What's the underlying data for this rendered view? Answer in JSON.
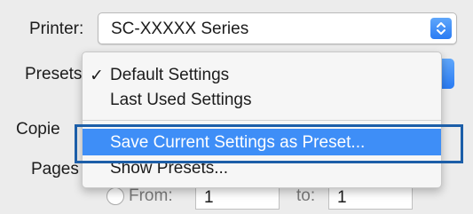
{
  "printer": {
    "label": "Printer:",
    "value": "SC-XXXXX Series",
    "stepper_icon": "updown-chevron-icon"
  },
  "presets": {
    "label": "Presets",
    "menu_items": [
      {
        "check": "✓",
        "label": "Default Settings",
        "checked": true
      },
      {
        "label": "Last Used Settings"
      },
      {
        "label": "Save Current Settings as Preset...",
        "highlighted": true
      },
      {
        "label": "Show Presets..."
      }
    ]
  },
  "copies": {
    "label": "Copie"
  },
  "pages": {
    "label": "Pages",
    "from_label": "From:",
    "from_value": "1",
    "to_label": "to:",
    "to_value": "1"
  },
  "colors": {
    "accent": "#3e8ef7",
    "highlight_frame": "#1c5ea8"
  }
}
